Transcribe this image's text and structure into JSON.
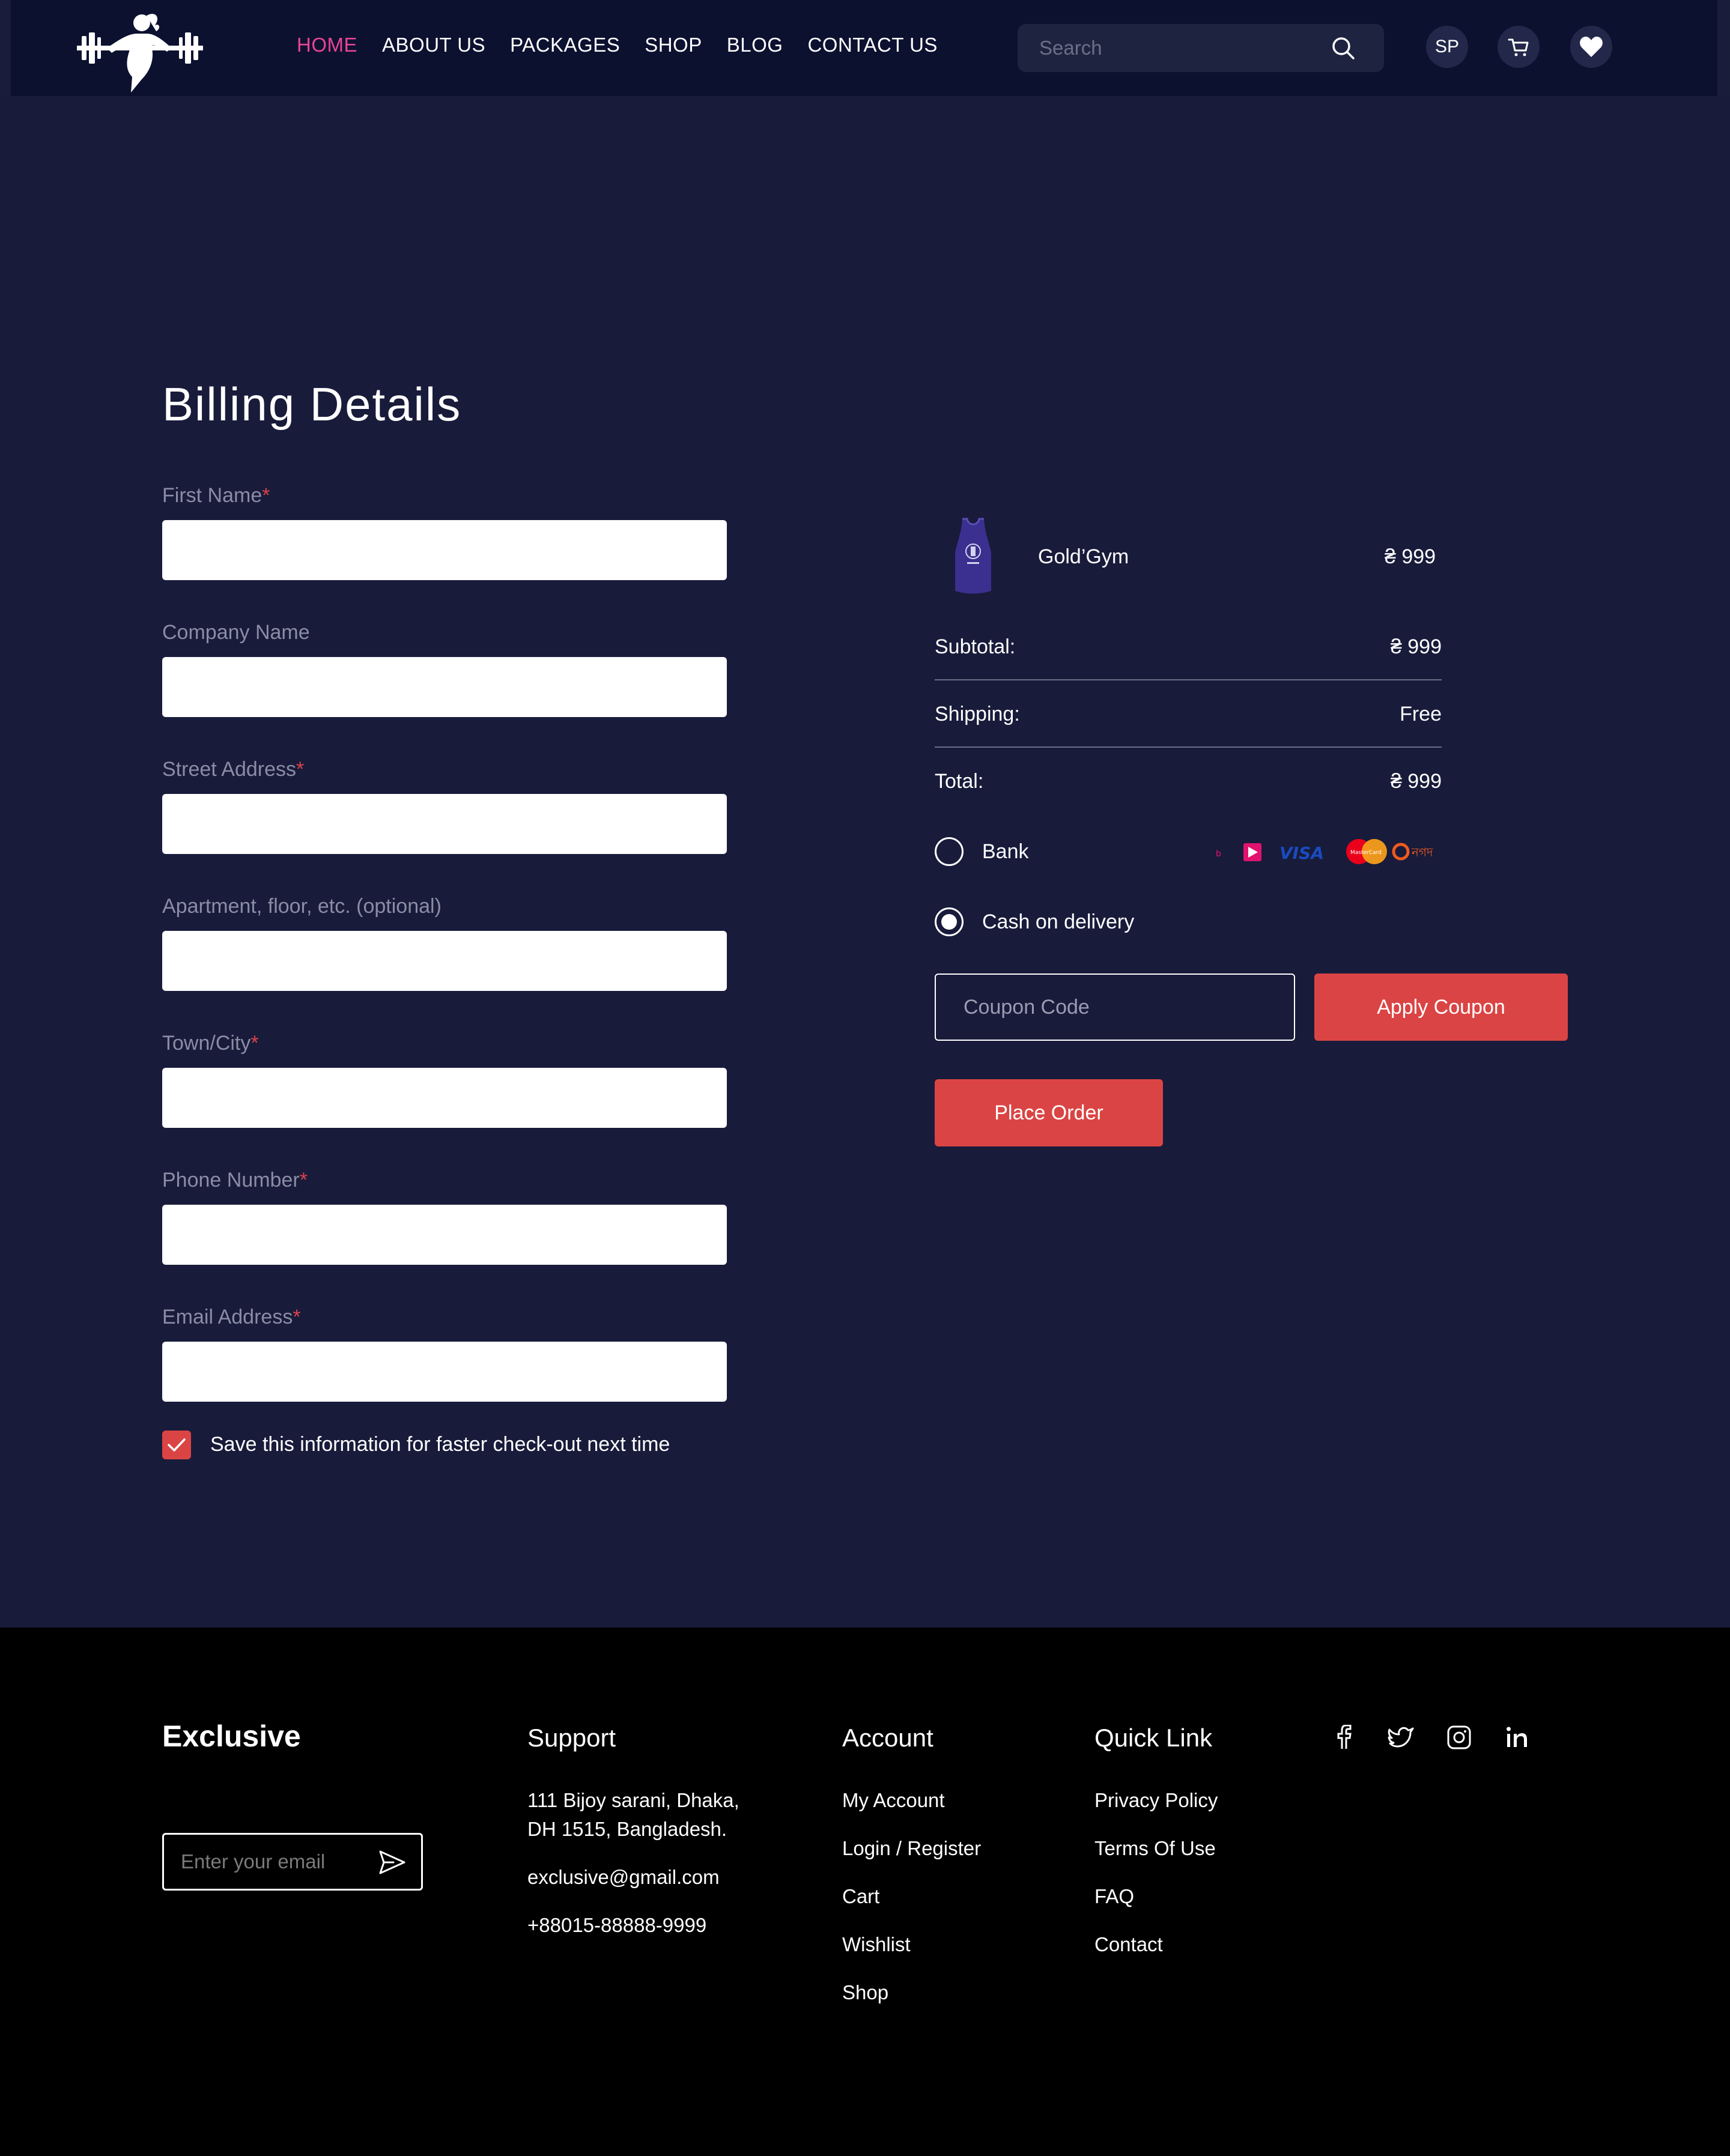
{
  "nav": {
    "items": [
      "HOME",
      "ABOUT US",
      "PACKAGES",
      "SHOP",
      "BLOG",
      "CONTACT US"
    ],
    "active": "HOME"
  },
  "search": {
    "placeholder": "Search",
    "icon": "search-icon"
  },
  "header_actions": {
    "avatar_initials": "SP",
    "cart_icon": "cart-icon",
    "wishlist_icon": "heart-icon"
  },
  "billing": {
    "title": "Billing Details",
    "fields": [
      {
        "label": "First Name",
        "required": true,
        "value": ""
      },
      {
        "label": "Company Name",
        "required": false,
        "value": ""
      },
      {
        "label": "Street Address",
        "required": true,
        "value": ""
      },
      {
        "label": "Apartment, floor, etc. (optional)",
        "required": false,
        "value": ""
      },
      {
        "label": "Town/City",
        "required": true,
        "value": ""
      },
      {
        "label": "Phone Number",
        "required": true,
        "value": ""
      },
      {
        "label": "Email Address",
        "required": true,
        "value": ""
      }
    ],
    "required_mark": "*",
    "save_info": {
      "label": "Save this information for faster check-out next time",
      "checked": true
    }
  },
  "order": {
    "product": {
      "name": "Gold’Gym",
      "price": "₴ 999"
    },
    "subtotal": {
      "label": "Subtotal:",
      "value": "₴ 999"
    },
    "shipping": {
      "label": "Shipping:",
      "value": "Free"
    },
    "total": {
      "label": "Total:",
      "value": "₴ 999"
    },
    "payment_methods": [
      {
        "label": "Bank",
        "selected": false
      },
      {
        "label": "Cash on delivery",
        "selected": true
      }
    ],
    "coupon_placeholder": "Coupon Code",
    "apply_label": "Apply Coupon",
    "place_order_label": "Place Order"
  },
  "footer": {
    "brand": "Exclusive",
    "email_placeholder": "Enter your email",
    "support": {
      "title": "Support",
      "address_line1": "111 Bijoy sarani, Dhaka,",
      "address_line2": "DH 1515, Bangladesh.",
      "email": "exclusive@gmail.com",
      "phone": "+88015-88888-9999"
    },
    "account": {
      "title": "Account",
      "links": [
        "My Account",
        "Login / Register",
        "Cart",
        "Wishlist",
        "Shop"
      ]
    },
    "quick_link": {
      "title": "Quick Link",
      "links": [
        "Privacy Policy",
        "Terms Of Use",
        "FAQ",
        "Contact"
      ]
    },
    "social_icons": [
      "facebook-icon",
      "twitter-icon",
      "instagram-icon",
      "linkedin-icon"
    ]
  },
  "colors": {
    "header_bg": "#0d1130",
    "main_bg": "#181b3a",
    "accent_red": "#db4444",
    "nav_active": "#e84593",
    "footer_bg": "#000000"
  }
}
